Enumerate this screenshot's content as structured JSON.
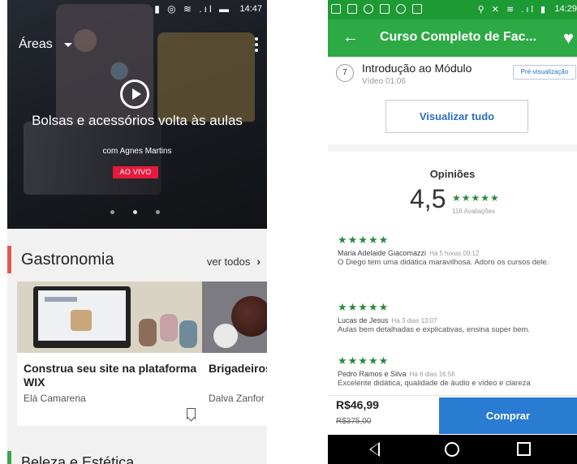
{
  "left": {
    "status": {
      "icons": "▮ ◎ ≋ .ıl ▬",
      "time": "14:47"
    },
    "toolbar": {
      "areas_label": "Áreas"
    },
    "hero": {
      "title": "Bolsas e acessórios volta às aulas",
      "subtitle": "com Agnes Martins",
      "live_badge": "AO VIVO",
      "carousel_pages": 3,
      "carousel_active": 1
    },
    "section": {
      "title": "Gastronomia",
      "see_all": "ver todos",
      "chevron": "›"
    },
    "courses": [
      {
        "title": "Construa seu site na plataforma WIX",
        "author": "Elá Camarena"
      },
      {
        "title": "Brigadeiros sabores e t",
        "author": "Dalva Zanfor"
      }
    ],
    "next_section": {
      "title": "Beleza e Estética"
    }
  },
  "right": {
    "status": {
      "time": "14:29",
      "icons": "⚲ ✕ ≋ .ıl ▮"
    },
    "appbar": {
      "back": "←",
      "title": "Curso Completo de Fac...",
      "heart": "♥"
    },
    "lesson": {
      "number": "7",
      "title": "Introdução ao Módulo",
      "meta": "Vídeo 01:06",
      "preview_label": "Pré-visualização"
    },
    "view_all_label": "Visualizar tudo",
    "reviews": {
      "heading": "Opiniões",
      "average": "4,5",
      "stars": "★★★★★",
      "count_label": "116 Avaliações",
      "items": [
        {
          "stars": "★★★★★",
          "name": "Maria Adelaide Giacomazzi",
          "when": "Há 5 horas 09:12",
          "text": "O Diego tem uma didática maravilhosa. Adoro os cursos dele."
        },
        {
          "stars": "★★★★★",
          "name": "Lucas de Jesus",
          "when": "Há 3 dias 13:07",
          "text": "Aulas bem detalhadas e explicativas, ensina super bem."
        },
        {
          "stars": "★★★★★",
          "name": "Pedro Ramos e Silva",
          "when": "Há 6 dias 16:56",
          "text": "Excelente didática, qualidade de áudio e vídeo e clareza"
        }
      ]
    },
    "purchase": {
      "price": "R$46,99",
      "old_price": "R$375,00",
      "buy_label": "Comprar"
    }
  },
  "colors": {
    "green_appbar": "#2daa45",
    "green_status": "#1e9a35",
    "blue_button": "#2a7bd2",
    "live_red": "#e8193c",
    "section_accent": "#e15a4c"
  }
}
